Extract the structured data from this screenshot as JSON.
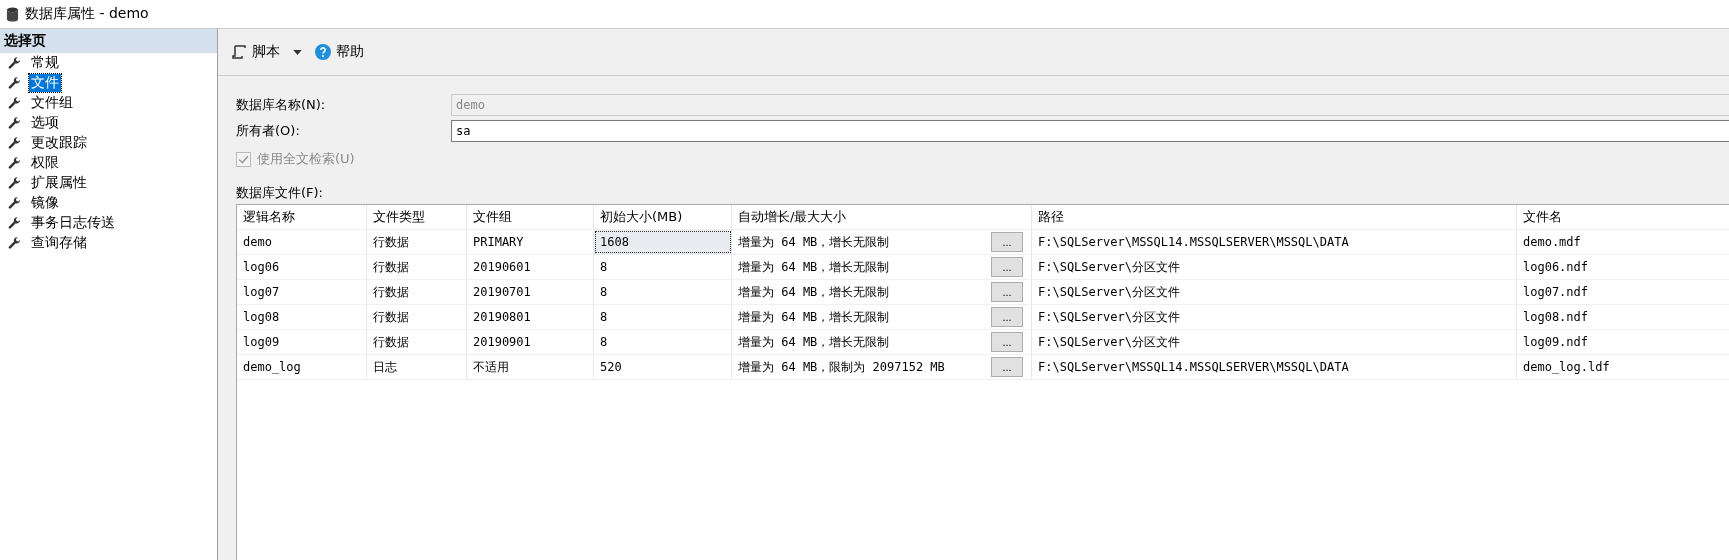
{
  "window": {
    "title": "数据库属性 - demo"
  },
  "sidebar": {
    "header": "选择页",
    "items": [
      {
        "label": "常规",
        "selected": false
      },
      {
        "label": "文件",
        "selected": true
      },
      {
        "label": "文件组",
        "selected": false
      },
      {
        "label": "选项",
        "selected": false
      },
      {
        "label": "更改跟踪",
        "selected": false
      },
      {
        "label": "权限",
        "selected": false
      },
      {
        "label": "扩展属性",
        "selected": false
      },
      {
        "label": "镜像",
        "selected": false
      },
      {
        "label": "事务日志传送",
        "selected": false
      },
      {
        "label": "查询存储",
        "selected": false
      }
    ]
  },
  "toolbar": {
    "script": "脚本",
    "help": "帮助"
  },
  "form": {
    "db_name_label": "数据库名称(N):",
    "db_name_value": "demo",
    "owner_label": "所有者(O):",
    "owner_value": "sa",
    "fulltext": {
      "label": "使用全文检索(U)",
      "checked": true,
      "disabled": true
    }
  },
  "table": {
    "title": "数据库文件(F):",
    "columns": [
      "逻辑名称",
      "文件类型",
      "文件组",
      "初始大小(MB)",
      "自动增长/最大大小",
      "路径",
      "文件名"
    ],
    "browse_button": "...",
    "rows": [
      {
        "cells": [
          "demo",
          "行数据",
          "PRIMARY",
          "1608",
          "增量为 64 MB，增长无限制",
          "F:\\SQLServer\\MSSQL14.MSSQLSERVER\\MSSQL\\DATA",
          "demo.mdf"
        ],
        "selected": true
      },
      {
        "cells": [
          "log06",
          "行数据",
          "20190601",
          "8",
          "增量为 64 MB，增长无限制",
          "F:\\SQLServer\\分区文件",
          "log06.ndf"
        ],
        "selected": false
      },
      {
        "cells": [
          "log07",
          "行数据",
          "20190701",
          "8",
          "增量为 64 MB，增长无限制",
          "F:\\SQLServer\\分区文件",
          "log07.ndf"
        ],
        "selected": false
      },
      {
        "cells": [
          "log08",
          "行数据",
          "20190801",
          "8",
          "增量为 64 MB，增长无限制",
          "F:\\SQLServer\\分区文件",
          "log08.ndf"
        ],
        "selected": false
      },
      {
        "cells": [
          "log09",
          "行数据",
          "20190901",
          "8",
          "增量为 64 MB，增长无限制",
          "F:\\SQLServer\\分区文件",
          "log09.ndf"
        ],
        "selected": false
      },
      {
        "cells": [
          "demo_log",
          "日志",
          "不适用",
          "520",
          "增量为 64 MB，限制为 2097152 MB",
          "F:\\SQLServer\\MSSQL14.MSSQLSERVER\\MSSQL\\DATA",
          "demo_log.ldf"
        ],
        "selected": false
      }
    ]
  }
}
